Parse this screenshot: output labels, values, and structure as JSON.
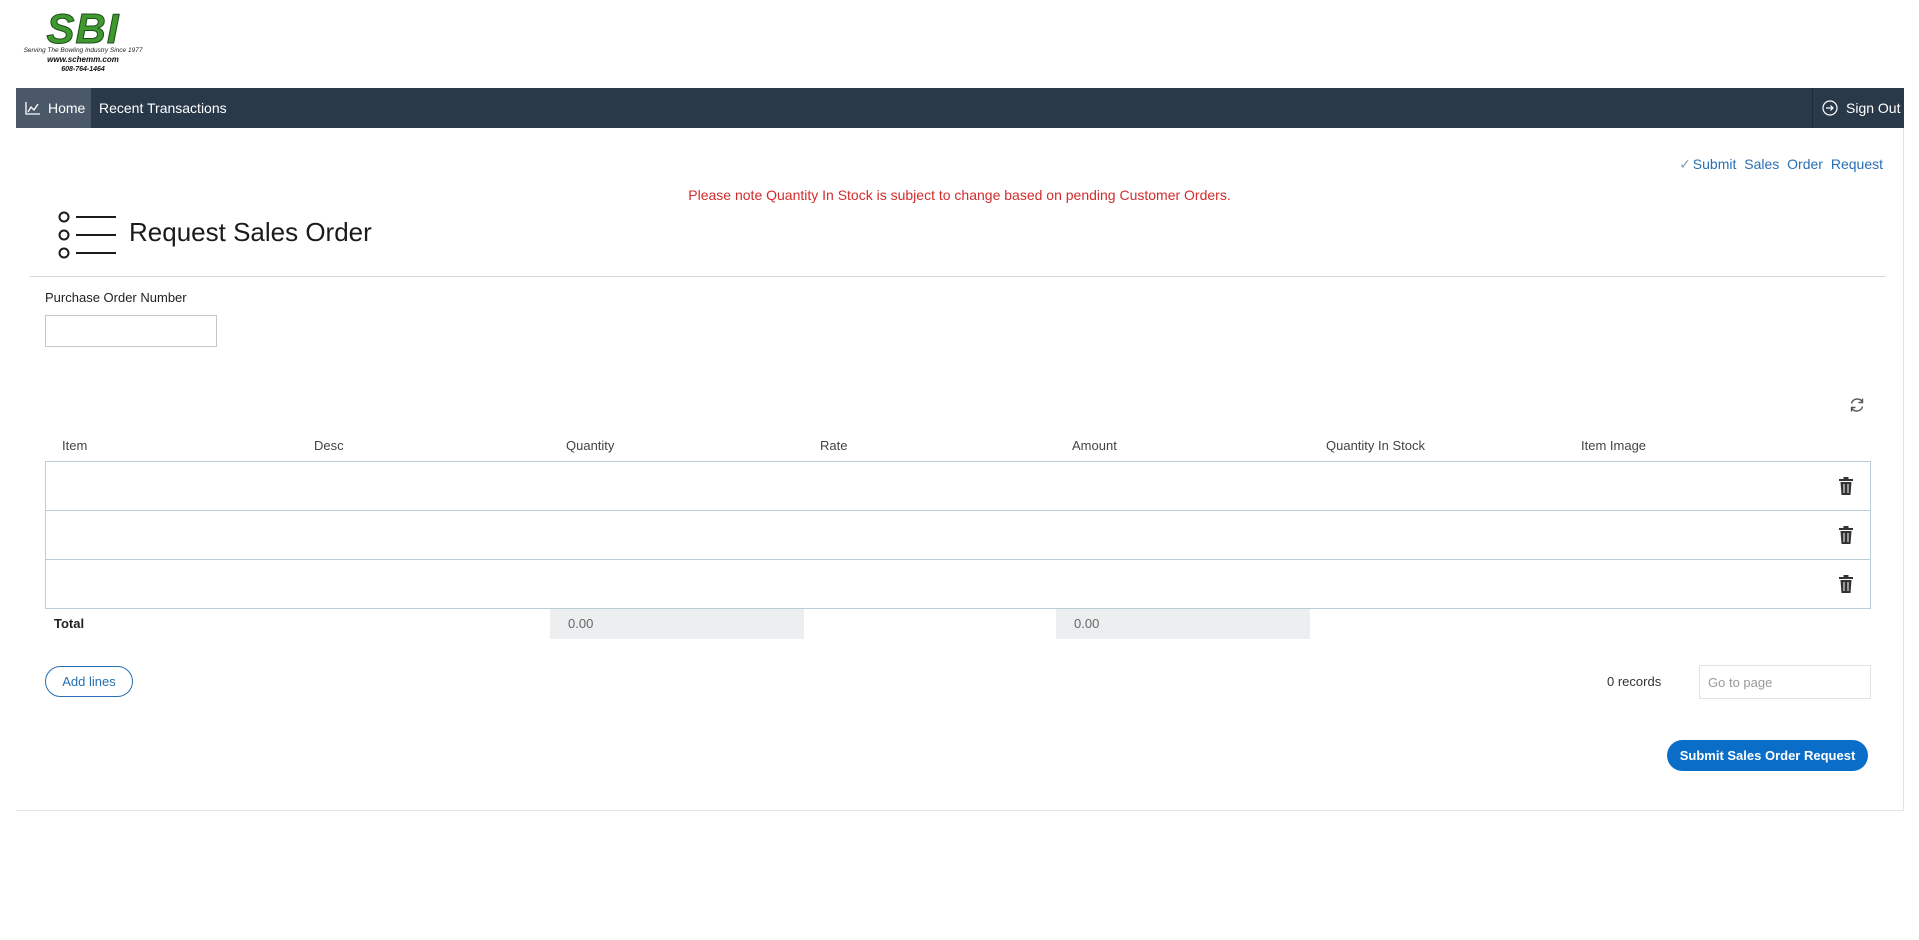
{
  "logo": {
    "name": "SBI",
    "tagline": "Serving The Bowling Industry Since 1977",
    "website": "www.schemm.com",
    "phone": "608-764-1464"
  },
  "nav": {
    "home_label": "Home",
    "recent_label": "Recent Transactions",
    "signout_label": "Sign Out"
  },
  "top_action_label": "Submit Sales Order Request",
  "notice": "Please note Quantity In Stock is subject to change based on pending Customer Orders.",
  "page_title": "Request Sales Order",
  "po": {
    "label": "Purchase Order Number",
    "value": ""
  },
  "table": {
    "columns": [
      "Item",
      "Desc",
      "Quantity",
      "Rate",
      "Amount",
      "Quantity In Stock",
      "Item Image"
    ],
    "row_count": 3
  },
  "totals": {
    "label": "Total",
    "quantity": "0.00",
    "amount": "0.00"
  },
  "add_lines_label": "Add lines",
  "records_label": "0 records",
  "goto_placeholder": "Go to page",
  "submit_label": "Submit Sales Order Request",
  "colors": {
    "nav_bg": "#29394a",
    "accent": "#0a6ec9",
    "notice": "#d12c2c"
  }
}
